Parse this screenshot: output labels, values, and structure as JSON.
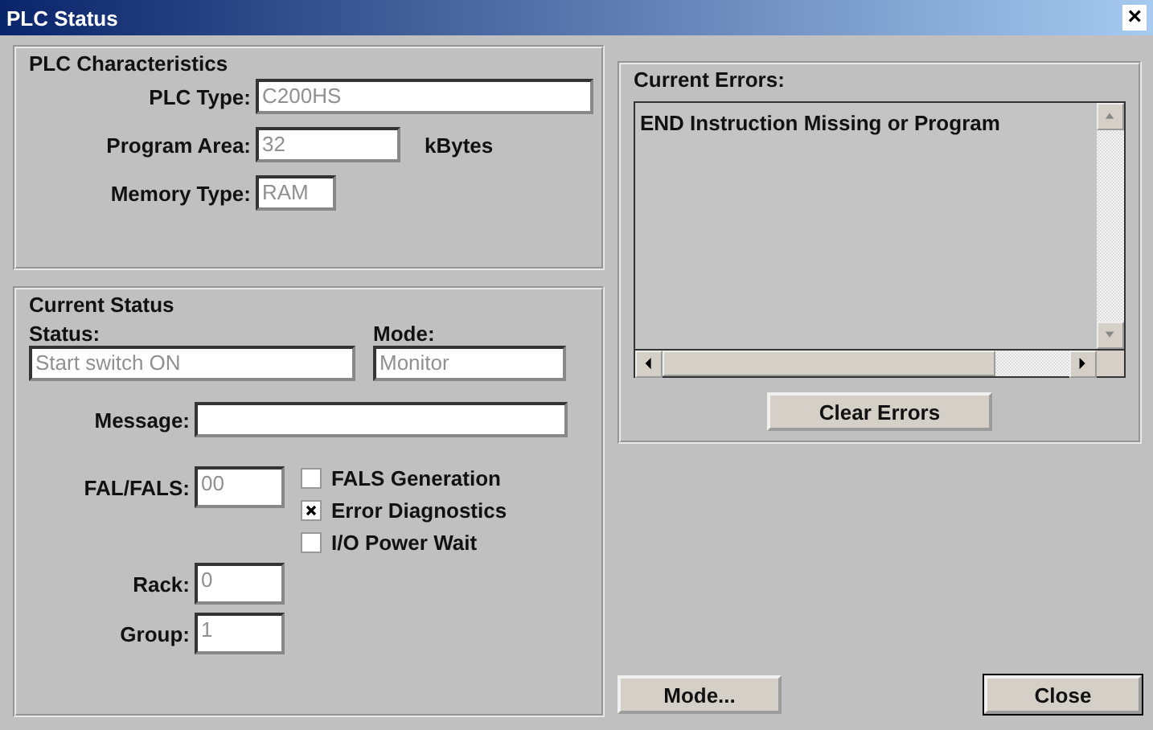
{
  "window": {
    "title": "PLC Status",
    "close": "×"
  },
  "plc_characteristics": {
    "title": "PLC Characteristics",
    "fields": [
      {
        "label": "PLC Type:",
        "value": "C200HS"
      },
      {
        "label": "Program Area:",
        "value": "32",
        "unit": "kBytes"
      },
      {
        "label": "Memory Type:",
        "value": "RAM"
      }
    ]
  },
  "current_status": {
    "title": "Current Status",
    "status": {
      "label": "Status:",
      "value": "Start switch ON"
    },
    "mode": {
      "label": "Mode:",
      "value": "Monitor"
    },
    "message": {
      "label": "Message:"
    },
    "fal_fals": {
      "label": "FAL/FALS:",
      "value": "00"
    },
    "checkboxes": [
      {
        "label": "FALS Generation",
        "checked": false
      },
      {
        "label": "Error Diagnostics",
        "checked": true
      },
      {
        "label": "I/O Power Wait",
        "checked": false
      }
    ],
    "rack": {
      "label": "Rack:",
      "value": "0"
    },
    "group": {
      "label": "Group:",
      "value": "1"
    }
  },
  "current_errors": {
    "title": "Current Errors:",
    "items": [
      "END Instruction Missing or Program"
    ],
    "button": "Clear Errors"
  },
  "buttons": [
    {
      "label": "Mode...",
      "default": false
    },
    {
      "label": "Close",
      "default": true
    }
  ]
}
